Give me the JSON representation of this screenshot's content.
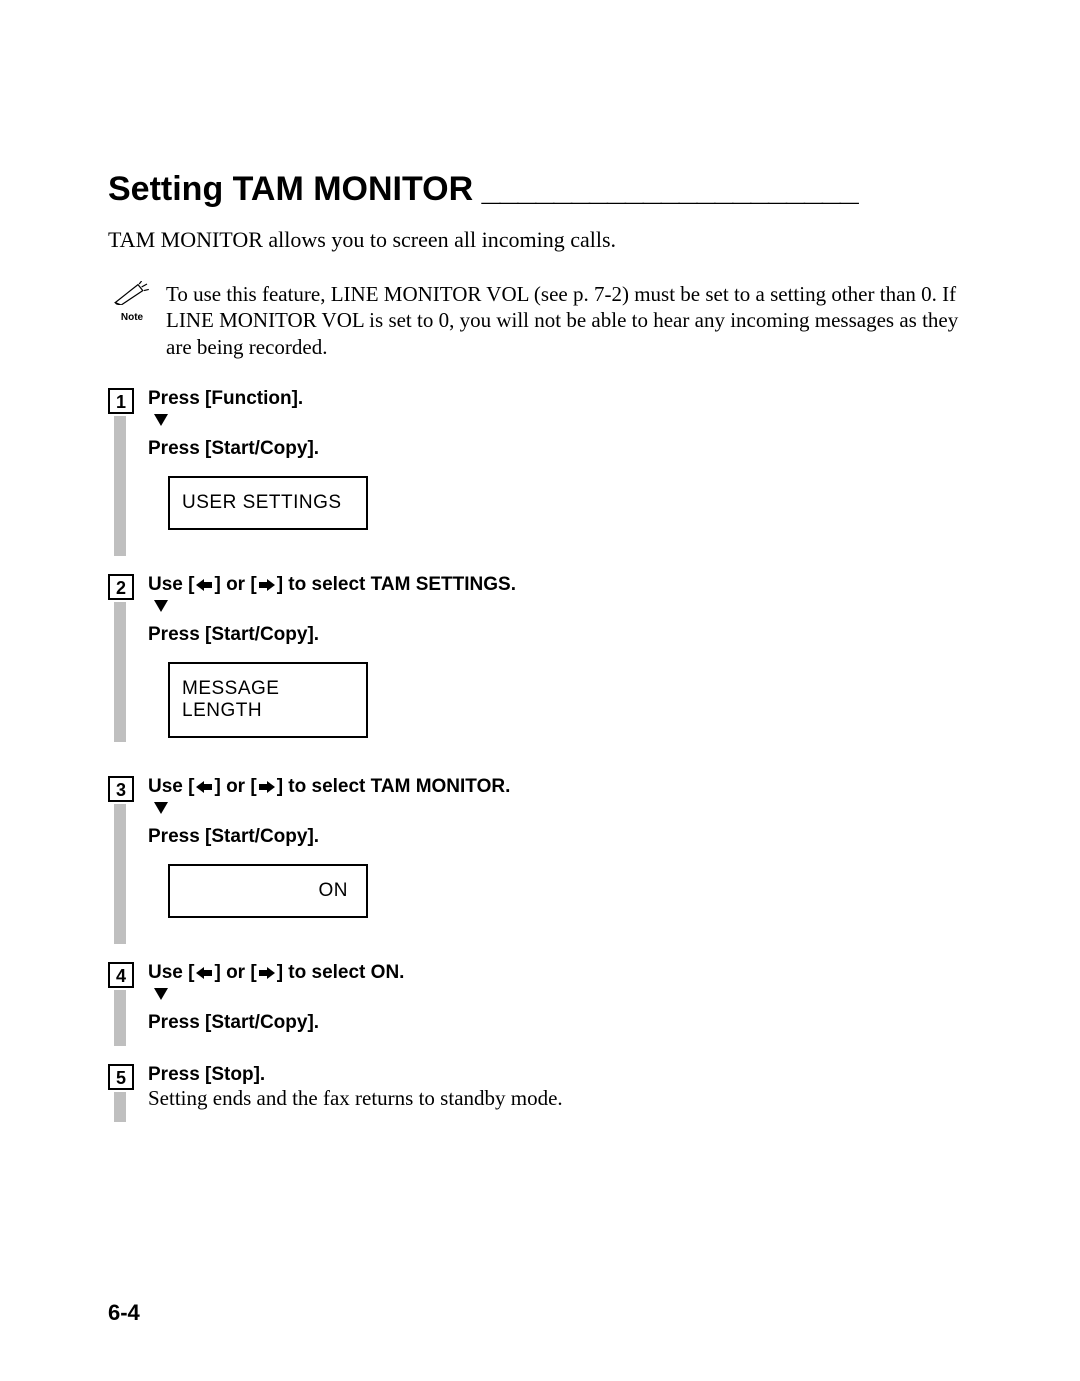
{
  "title": "Setting TAM MONITOR",
  "title_dash": " _____________________",
  "intro": "TAM MONITOR allows you to screen all incoming calls.",
  "note": {
    "label": "Note",
    "text": "To use this feature, LINE MONITOR VOL (see p. 7-2) must be set to a setting other than 0. If LINE MONITOR VOL is set to 0, you will not be able to hear any incoming messages as they are being recorded."
  },
  "steps": {
    "s1": {
      "no": "1",
      "line1": "Press [Function].",
      "line2": "Press [Start/Copy].",
      "lcd": "USER SETTINGS"
    },
    "s2": {
      "no": "2",
      "use": "Use [",
      "or": "] or [",
      "end": "] to select ",
      "sel": "TAM SETTINGS.",
      "line2": "Press [Start/Copy].",
      "lcd": "MESSAGE LENGTH"
    },
    "s3": {
      "no": "3",
      "use": "Use [",
      "or": "] or [",
      "end": "] to select ",
      "sel": "TAM MONITOR.",
      "line2": "Press [Start/Copy].",
      "lcd": "ON"
    },
    "s4": {
      "no": "4",
      "use": "Use [",
      "or": "] or [",
      "end": "] to select ",
      "sel": "ON.",
      "line2": "Press [Start/Copy]."
    },
    "s5": {
      "no": "5",
      "line1": "Press [Stop].",
      "line2": "Setting ends and the fax returns to standby mode."
    }
  },
  "page_no": "6-4"
}
